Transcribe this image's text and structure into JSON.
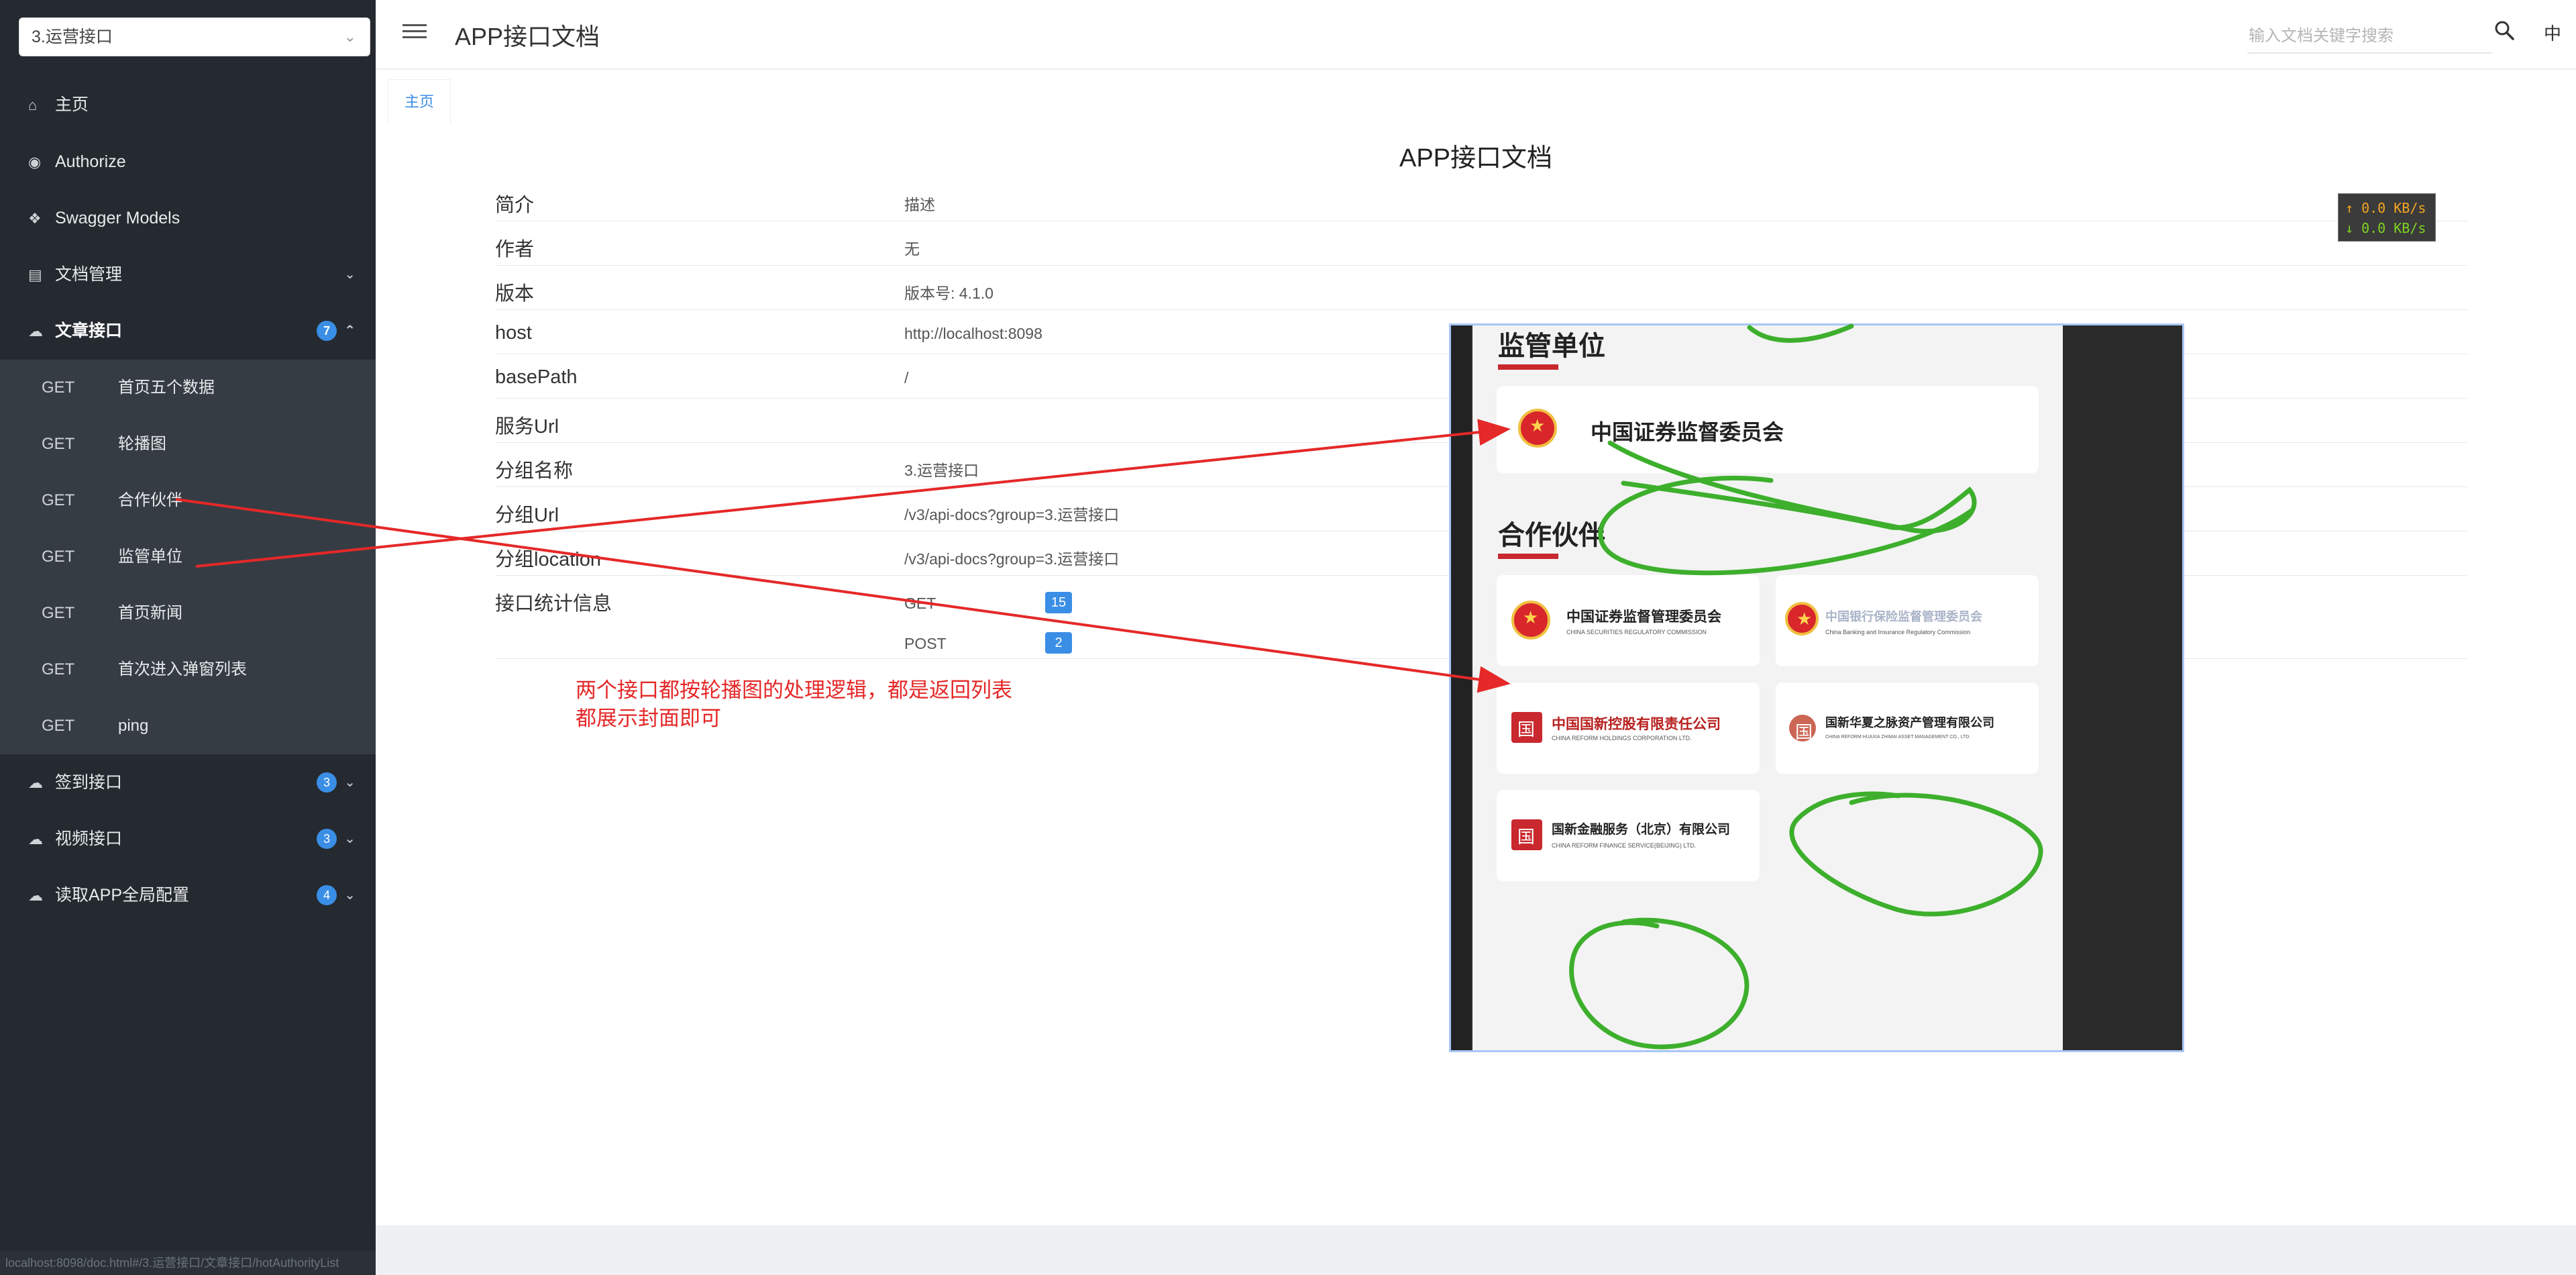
{
  "sidebar": {
    "group_select": "3.运营接口",
    "items": [
      {
        "label": "主页",
        "icon": "home-icon"
      },
      {
        "label": "Authorize",
        "icon": "lock-icon"
      },
      {
        "label": "Swagger Models",
        "icon": "cube-icon"
      },
      {
        "label": "文档管理",
        "icon": "document-icon"
      },
      {
        "label": "文章接口",
        "icon": "cloud-icon",
        "badge": "7"
      },
      {
        "label": "签到接口",
        "icon": "cloud-icon",
        "badge": "3"
      },
      {
        "label": "视频接口",
        "icon": "cloud-icon",
        "badge": "3"
      },
      {
        "label": "读取APP全局配置",
        "icon": "cloud-icon",
        "badge": "4"
      }
    ],
    "sub_items": [
      {
        "method": "GET",
        "label": "首页五个数据"
      },
      {
        "method": "GET",
        "label": "轮播图"
      },
      {
        "method": "GET",
        "label": "合作伙伴"
      },
      {
        "method": "GET",
        "label": "监管单位"
      },
      {
        "method": "GET",
        "label": "首页新闻"
      },
      {
        "method": "GET",
        "label": "首次进入弹窗列表"
      },
      {
        "method": "GET",
        "label": "ping"
      }
    ],
    "footer": "localhost:8098/doc.html#/3.运营接口/文章接口/hotAuthorityList"
  },
  "header": {
    "title": "APP接口文档",
    "search_placeholder": "输入文档关键字搜索",
    "lang": "中"
  },
  "tabs": [
    {
      "label": "主页"
    }
  ],
  "main": {
    "doc_title": "APP接口文档",
    "rows": [
      {
        "key": "简介",
        "value": "描述"
      },
      {
        "key": "作者",
        "value": "无"
      },
      {
        "key": "版本",
        "value": "版本号: 4.1.0"
      },
      {
        "key": "host",
        "value": "http://localhost:8098"
      },
      {
        "key": "basePath",
        "value": "/"
      },
      {
        "key": "服务Url",
        "value": ""
      },
      {
        "key": "分组名称",
        "value": "3.运营接口"
      },
      {
        "key": "分组Url",
        "value": "/v3/api-docs?group=3.运营接口"
      },
      {
        "key": "分组location",
        "value": "/v3/api-docs?group=3.运营接口"
      },
      {
        "key": "接口统计信息",
        "value": ""
      }
    ],
    "stats": [
      {
        "method": "GET",
        "count": "15"
      },
      {
        "method": "POST",
        "count": "2"
      }
    ],
    "annotation_lines": [
      "两个接口都按轮播图的处理逻辑，都是返回列表",
      "都展示封面即可"
    ]
  },
  "net_speed": {
    "up": "↑ 0.0 KB/s",
    "down": "↓ 0.0 KB/s"
  },
  "embedded": {
    "section_regulator": "监管单位",
    "regulator": "中国证券监督委员会",
    "section_partner": "合作伙伴",
    "partners": [
      {
        "name": "中国证券监督管理委员会",
        "en": "CHINA SECURITIES REGULATORY COMMISSION"
      },
      {
        "name": "中国银行保险监督管理委员会",
        "en": "China Banking and Insurance Regulatory Commission"
      },
      {
        "name": "中国国新控股有限责任公司",
        "en": "CHINA REFORM HOLDINGS CORPORATION LTD."
      },
      {
        "name": "国新华夏之脉资产管理有限公司",
        "en": "CHINA REFORM HUAXIA ZHIMAI ASSET MANAGEMENT CO., LTD."
      },
      {
        "name": "国新金融服务（北京）有限公司",
        "en": "CHINA REFORM FINANCE SERVICE(BEIJING) LTD."
      }
    ]
  },
  "colors": {
    "sidebar_bg": "#242a30",
    "submenu_bg": "#353c44",
    "accent": "#3a8ee6",
    "annotation_red": "#e52828",
    "scribble_green": "#3daf2c"
  }
}
